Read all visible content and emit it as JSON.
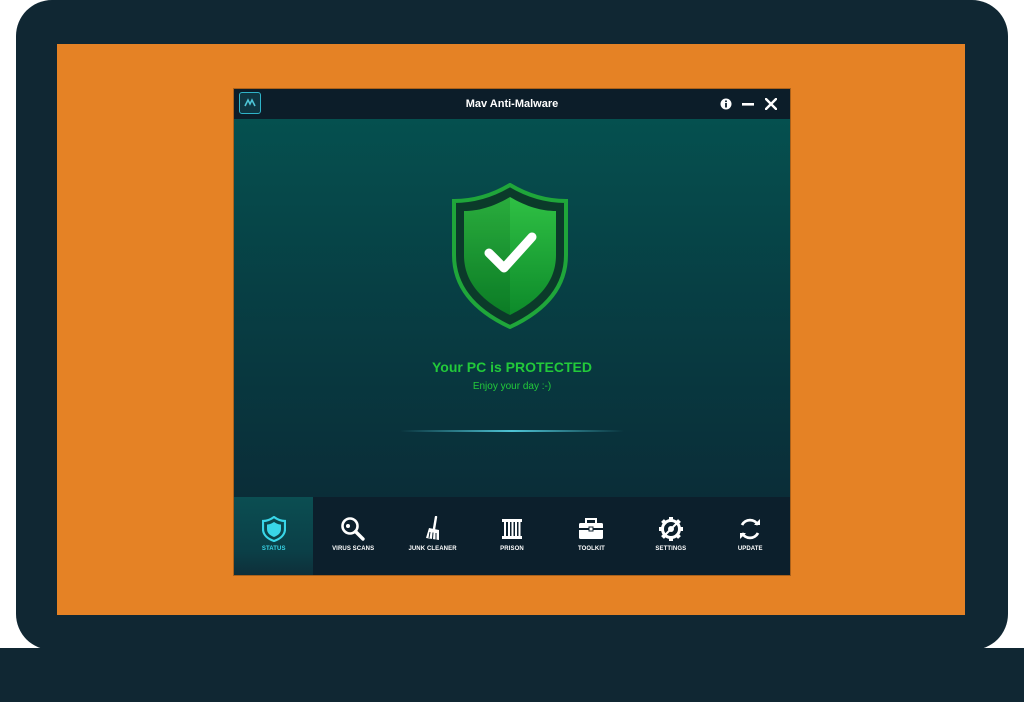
{
  "window": {
    "title": "Mav Anti-Malware",
    "buttons": [
      "info-icon",
      "minimize-icon",
      "close-icon"
    ]
  },
  "status": {
    "headline": "Your PC is PROTECTED",
    "subtext": "Enjoy your day :-)",
    "icon": "shield-check-icon"
  },
  "nav": {
    "active": "STATUS",
    "items": [
      {
        "label": "STATUS",
        "icon": "shield-icon"
      },
      {
        "label": "VIRUS SCANS",
        "icon": "magnifier-icon"
      },
      {
        "label": "JUNK CLEANER",
        "icon": "broom-icon"
      },
      {
        "label": "PRISON",
        "icon": "prison-bars-icon"
      },
      {
        "label": "TOOLKIT",
        "icon": "toolbox-icon"
      },
      {
        "label": "SETTINGS",
        "icon": "gear-icon"
      },
      {
        "label": "UPDATE",
        "icon": "refresh-icon"
      }
    ]
  },
  "colors": {
    "laptop_frame": "#102733",
    "screen_wallpaper": "#e58225",
    "status_green": "#22c93a",
    "accent_cyan": "#39d6e8"
  }
}
